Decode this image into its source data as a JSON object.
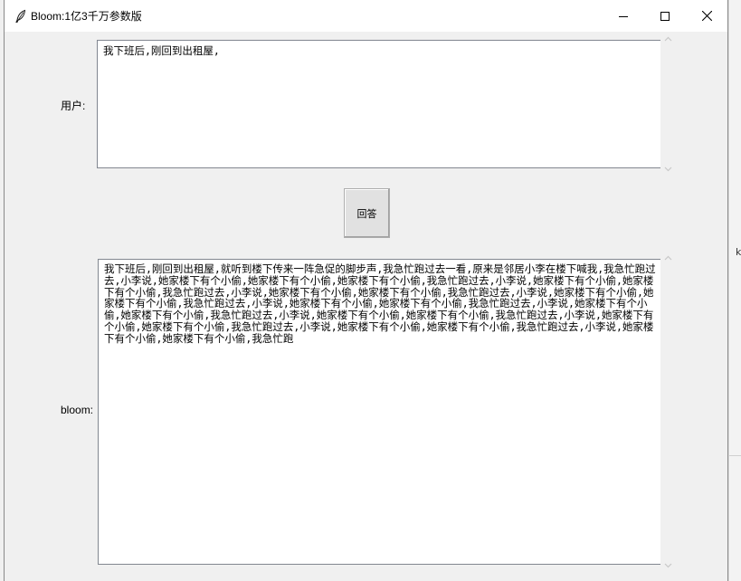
{
  "window": {
    "title": "Bloom:1亿3千万参数版"
  },
  "form": {
    "user_label": "用户:",
    "user_input": "我下班后,刚回到出租屋,",
    "answer_button": "回答",
    "bloom_label": "bloom:",
    "bloom_output": "我下班后,刚回到出租屋,就听到楼下传来一阵急促的脚步声,我急忙跑过去一看,原来是邻居小李在楼下喊我,我急忙跑过去,小李说,她家楼下有个小偷,她家楼下有个小偷,她家楼下有个小偷,我急忙跑过去,小李说,她家楼下有个小偷,她家楼下有个小偷,我急忙跑过去,小李说,她家楼下有个小偷,她家楼下有个小偷,我急忙跑过去,小李说,她家楼下有个小偷,她家楼下有个小偷,我急忙跑过去,小李说,她家楼下有个小偷,她家楼下有个小偷,我急忙跑过去,小李说,她家楼下有个小偷,她家楼下有个小偷,我急忙跑过去,小李说,她家楼下有个小偷,她家楼下有个小偷,我急忙跑过去,小李说,她家楼下有个小偷,她家楼下有个小偷,我急忙跑过去,小李说,她家楼下有个小偷,她家楼下有个小偷,我急忙跑过去,小李说,她家楼下有个小偷,她家楼下有个小偷,我急忙跑"
  },
  "backdrop": {
    "edge_char": "k"
  },
  "icons": {
    "app": "feather-icon",
    "minimize": "minimize-icon",
    "maximize": "maximize-icon",
    "close": "close-icon",
    "scroll_up": "chevron-up-icon",
    "scroll_down": "chevron-down-icon"
  }
}
